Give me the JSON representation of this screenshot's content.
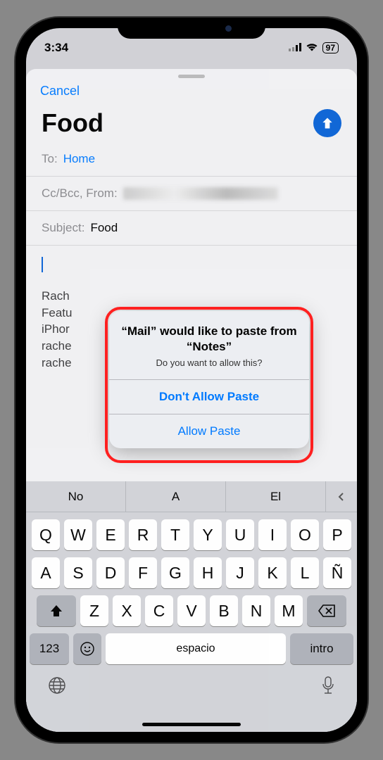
{
  "status": {
    "time": "3:34",
    "battery": "97"
  },
  "topbar": {
    "cancel": "Cancel"
  },
  "compose": {
    "title": "Food",
    "to_label": "To:",
    "to_value": "Home",
    "cc_label": "Cc/Bcc, From:",
    "subject_label": "Subject:",
    "subject_value": "Food",
    "body_lines": [
      "Rach",
      "Featu",
      "iPhor",
      "rache",
      "rache"
    ]
  },
  "alert": {
    "title": "“Mail” would like to paste from “Notes”",
    "message": "Do you want to allow this?",
    "deny": "Don't Allow Paste",
    "allow": "Allow Paste"
  },
  "keyboard": {
    "suggestions": [
      "No",
      "A",
      "El"
    ],
    "row1": [
      "Q",
      "W",
      "E",
      "R",
      "T",
      "Y",
      "U",
      "I",
      "O",
      "P"
    ],
    "row2": [
      "A",
      "S",
      "D",
      "F",
      "G",
      "H",
      "J",
      "K",
      "L",
      "Ñ"
    ],
    "row3": [
      "Z",
      "X",
      "C",
      "V",
      "B",
      "N",
      "M"
    ],
    "numkey": "123",
    "space": "espacio",
    "return": "intro"
  }
}
